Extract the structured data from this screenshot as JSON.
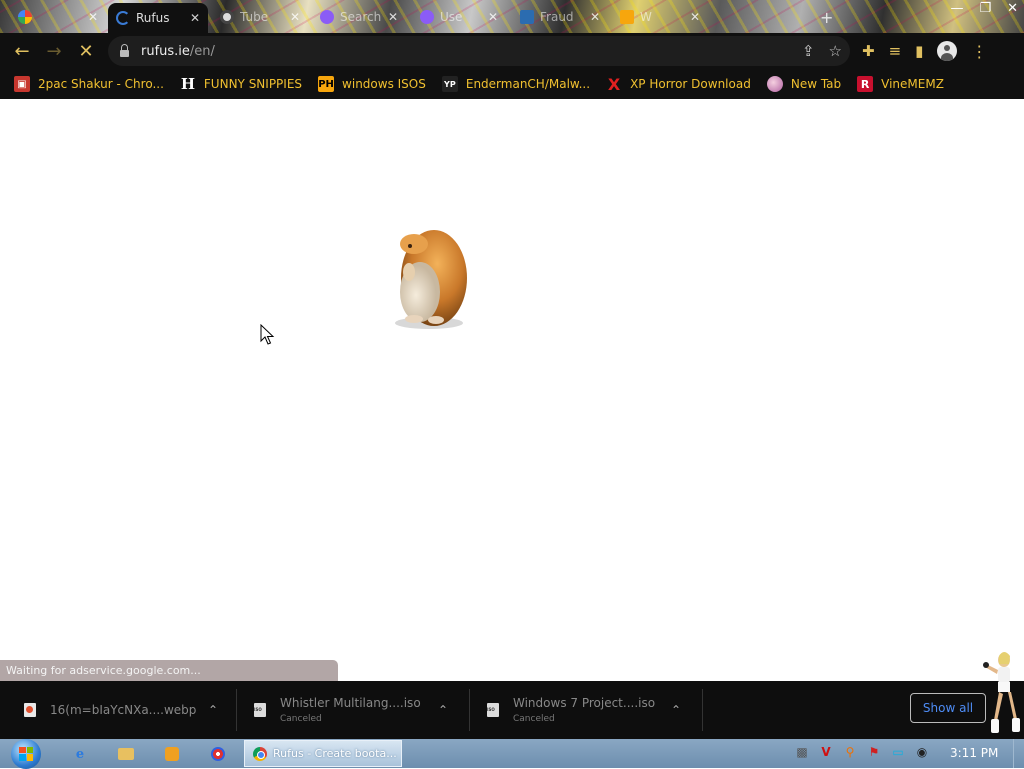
{
  "tabs": [
    {
      "label": "",
      "active": false
    },
    {
      "label": "Rufus",
      "active": true
    },
    {
      "label": "Tube",
      "active": false
    },
    {
      "label": "Search",
      "active": false
    },
    {
      "label": "Use",
      "active": false
    },
    {
      "label": "Fraud",
      "active": false
    },
    {
      "label": "W",
      "active": false
    }
  ],
  "address": {
    "host": "rufus.ie",
    "path": "/en/"
  },
  "bookmarks": [
    {
      "label": "2pac Shakur - Chro..."
    },
    {
      "label": "FUNNY SNIPPIES",
      "icon_text": "H"
    },
    {
      "label": "windows ISOS",
      "icon_text": "PH"
    },
    {
      "label": "EndermanCH/Malw...",
      "icon_text": "YP"
    },
    {
      "label": "XP Horror Download",
      "icon_text": "X"
    },
    {
      "label": "New Tab"
    },
    {
      "label": "VineMEMZ",
      "icon_text": "R"
    }
  ],
  "status_text": "Waiting for adservice.google.com...",
  "downloads": [
    {
      "name": "16(m=bIaYcNXa....webp",
      "status": ""
    },
    {
      "name": "Whistler Multilang....iso",
      "status": "Canceled"
    },
    {
      "name": "Windows 7 Project....iso",
      "status": "Canceled"
    }
  ],
  "show_all_label": "Show all",
  "taskbar": {
    "window_title": "Rufus - Create boota...",
    "clock": "3:11 PM"
  },
  "colors": {
    "bookmark_text": "#f0c030",
    "accent_blue": "#4e8cf5",
    "toolbar_bg": "#101010"
  }
}
